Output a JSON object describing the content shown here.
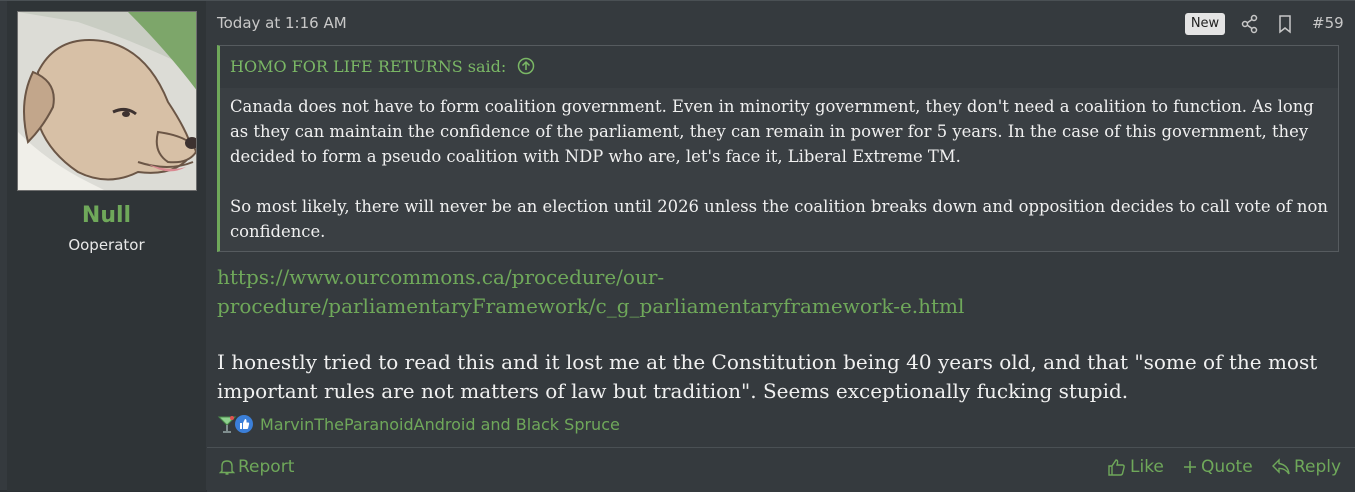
{
  "author": {
    "name": "Null",
    "title": "Ooperator"
  },
  "header": {
    "date": "Today at 1:16 AM",
    "badge": "New",
    "post_number": "#59"
  },
  "quote": {
    "attribution": "HOMO FOR LIFE RETURNS said:",
    "paragraphs": [
      "Canada does not have to form coalition government. Even in minority government, they don't need a coalition to function. As long as they can maintain the confidence of the parliament, they can remain in power for 5 years. In the case of this government, they decided to form a pseudo coalition with NDP who are, let's face it, Liberal Extreme TM.",
      "So most likely, there will never be an election until 2026 unless the coalition breaks down and opposition decides to call vote of non confidence."
    ]
  },
  "link": {
    "text": "https://www.ourcommons.ca/procedure/our-procedure/parliamentaryFramework/c_g_parliamentaryframework-e.html"
  },
  "message": "I honestly tried to read this and it lost me at the Constitution being 40 years old, and that \"some of the most important rules are not matters of law but tradition\". Seems exceptionally fucking stupid.",
  "reactions": {
    "names": "MarvinTheParanoidAndroid and Black Spruce"
  },
  "footer": {
    "report": "Report",
    "like": "Like",
    "quote": "Quote",
    "reply": "Reply"
  },
  "colors": {
    "accent": "#6fa85a",
    "background": "#353a3e",
    "sidebar": "#2f3437"
  },
  "icons": [
    "share-icon",
    "bookmark-icon",
    "arrow-up-circle-icon",
    "cocktail-icon",
    "thumbs-up-icon",
    "bell-icon",
    "plus-icon",
    "reply-icon"
  ]
}
